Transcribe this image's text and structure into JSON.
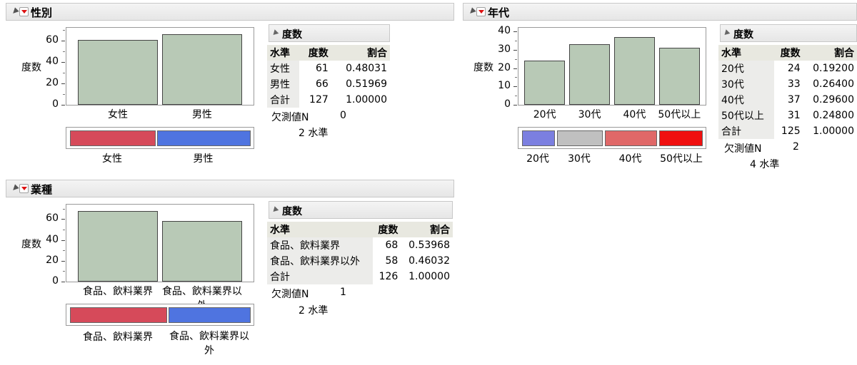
{
  "panels": {
    "gender": {
      "title": "性別",
      "y_axis_label": "度数",
      "freq_header": "度数",
      "col_level": "水準",
      "col_count": "度数",
      "col_prop": "割合",
      "rows": [
        {
          "level": "女性",
          "count": "61",
          "prop": "0.48031"
        },
        {
          "level": "男性",
          "count": "66",
          "prop": "0.51969"
        },
        {
          "level": "合計",
          "count": "127",
          "prop": "1.00000"
        }
      ],
      "missing_label": "欠測値N",
      "missing_value": "0",
      "levels_note": "2 水準",
      "legend": [
        {
          "label": "女性",
          "color": "#d64a5a"
        },
        {
          "label": "男性",
          "color": "#4f74e0"
        }
      ]
    },
    "age": {
      "title": "年代",
      "y_axis_label": "度数",
      "freq_header": "度数",
      "col_level": "水準",
      "col_count": "度数",
      "col_prop": "割合",
      "rows": [
        {
          "level": "20代",
          "count": "24",
          "prop": "0.19200"
        },
        {
          "level": "30代",
          "count": "33",
          "prop": "0.26400"
        },
        {
          "level": "40代",
          "count": "37",
          "prop": "0.29600"
        },
        {
          "level": "50代以上",
          "count": "31",
          "prop": "0.24800"
        },
        {
          "level": "合計",
          "count": "125",
          "prop": "1.00000"
        }
      ],
      "missing_label": "欠測値N",
      "missing_value": "2",
      "levels_note": "4 水準",
      "legend": [
        {
          "label": "20代",
          "color": "#7b7fe0"
        },
        {
          "label": "30代",
          "color": "#c0c0c0"
        },
        {
          "label": "40代",
          "color": "#e06868"
        },
        {
          "label": "50代以上",
          "color": "#f01010"
        }
      ]
    },
    "industry": {
      "title": "業種",
      "y_axis_label": "度数",
      "freq_header": "度数",
      "col_level": "水準",
      "col_count": "度数",
      "col_prop": "割合",
      "rows": [
        {
          "level": "食品、飲料業界",
          "count": "68",
          "prop": "0.53968"
        },
        {
          "level": "食品、飲料業界以外",
          "count": "58",
          "prop": "0.46032"
        },
        {
          "level": "合計",
          "count": "126",
          "prop": "1.00000"
        }
      ],
      "missing_label": "欠測値N",
      "missing_value": "1",
      "levels_note": "2 水準",
      "legend": [
        {
          "label": "食品、飲料業界",
          "color": "#d64a5a"
        },
        {
          "label": "食品、飲料業界以外",
          "color": "#4f74e0"
        }
      ]
    }
  },
  "chart_data": [
    {
      "type": "bar",
      "categories": [
        "女性",
        "男性"
      ],
      "values": [
        61,
        66
      ],
      "ylabel": "度数",
      "ylim": [
        0,
        72
      ],
      "yticks": [
        0,
        20,
        40,
        60
      ]
    },
    {
      "type": "bar",
      "categories": [
        "20代",
        "30代",
        "40代",
        "50代以上"
      ],
      "values": [
        24,
        33,
        37,
        31
      ],
      "ylabel": "度数",
      "ylim": [
        0,
        42
      ],
      "yticks": [
        0,
        10,
        20,
        30,
        40
      ]
    },
    {
      "type": "bar",
      "categories": [
        "食品、飲料業界",
        "食品、飲料業界以外"
      ],
      "values": [
        68,
        58
      ],
      "ylabel": "度数",
      "ylim": [
        0,
        74
      ],
      "yticks": [
        0,
        20,
        40,
        60
      ]
    }
  ]
}
